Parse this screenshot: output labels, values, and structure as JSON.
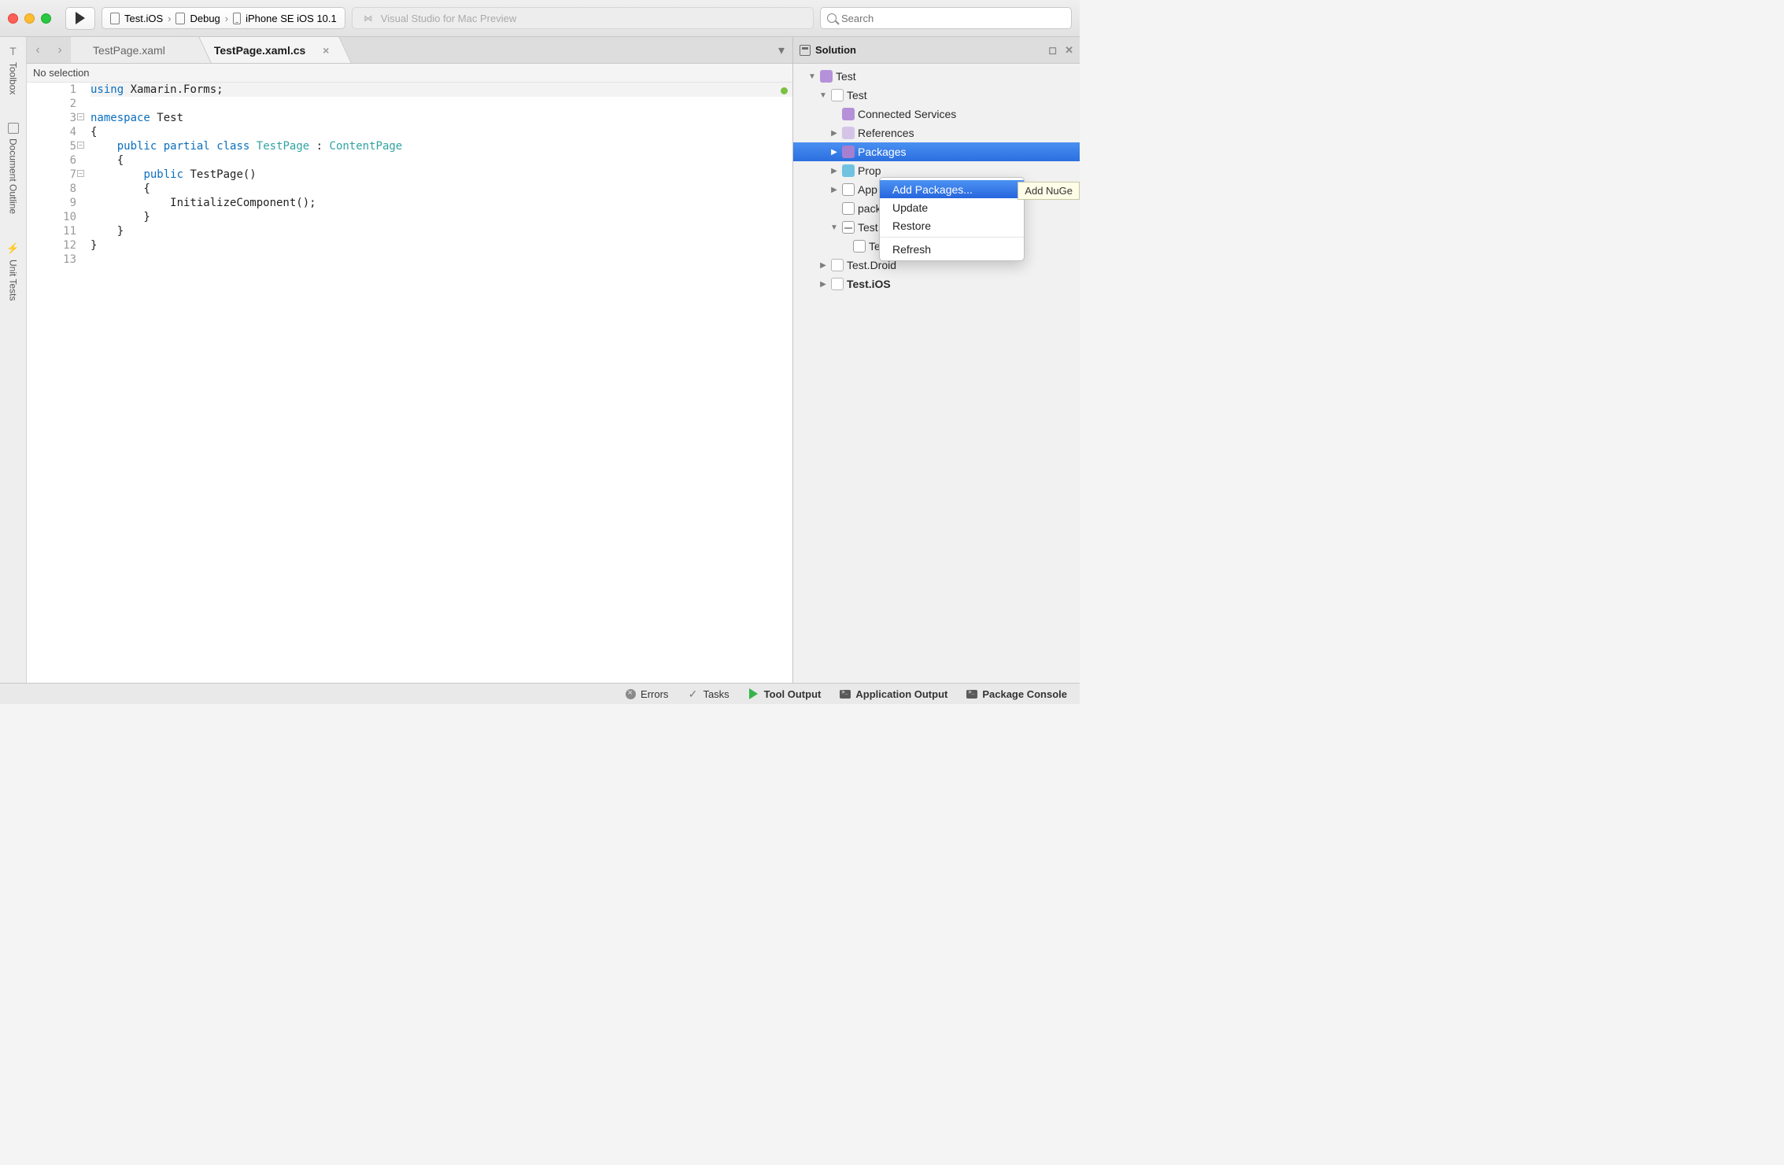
{
  "toolbar": {
    "breadcrumb": {
      "project": "Test.iOS",
      "config": "Debug",
      "device": "iPhone SE iOS 10.1"
    },
    "title": "Visual Studio for Mac Preview",
    "search_placeholder": "Search"
  },
  "left_tabs": [
    "Toolbox",
    "Document Outline",
    "Unit Tests"
  ],
  "editor": {
    "nav_label": "No selection",
    "tabs": [
      {
        "label": "TestPage.xaml",
        "active": false
      },
      {
        "label": "TestPage.xaml.cs",
        "active": true
      }
    ],
    "code_lines": [
      {
        "n": 1,
        "seg": [
          [
            "kw",
            "using"
          ],
          [
            "plain",
            " Xamarin.Forms;"
          ]
        ],
        "fold": false
      },
      {
        "n": 2,
        "seg": [],
        "fold": false
      },
      {
        "n": 3,
        "seg": [
          [
            "kw",
            "namespace"
          ],
          [
            "plain",
            " Test"
          ]
        ],
        "fold": true
      },
      {
        "n": 4,
        "seg": [
          [
            "plain",
            "{"
          ]
        ],
        "fold": false
      },
      {
        "n": 5,
        "seg": [
          [
            "plain",
            "    "
          ],
          [
            "kw",
            "public"
          ],
          [
            "plain",
            " "
          ],
          [
            "kw",
            "partial"
          ],
          [
            "plain",
            " "
          ],
          [
            "kw",
            "class"
          ],
          [
            "plain",
            " "
          ],
          [
            "type",
            "TestPage"
          ],
          [
            "plain",
            " : "
          ],
          [
            "type",
            "ContentPage"
          ]
        ],
        "fold": true
      },
      {
        "n": 6,
        "seg": [
          [
            "plain",
            "    {"
          ]
        ],
        "fold": false
      },
      {
        "n": 7,
        "seg": [
          [
            "plain",
            "        "
          ],
          [
            "kw",
            "public"
          ],
          [
            "plain",
            " TestPage()"
          ]
        ],
        "fold": true
      },
      {
        "n": 8,
        "seg": [
          [
            "plain",
            "        {"
          ]
        ],
        "fold": false
      },
      {
        "n": 9,
        "seg": [
          [
            "plain",
            "            InitializeComponent();"
          ]
        ],
        "fold": false
      },
      {
        "n": 10,
        "seg": [
          [
            "plain",
            "        }"
          ]
        ],
        "fold": false
      },
      {
        "n": 11,
        "seg": [
          [
            "plain",
            "    }"
          ]
        ],
        "fold": false
      },
      {
        "n": 12,
        "seg": [
          [
            "plain",
            "}"
          ]
        ],
        "fold": false
      },
      {
        "n": 13,
        "seg": [],
        "fold": false
      }
    ]
  },
  "solution": {
    "title": "Solution",
    "tree": [
      {
        "indent": 1,
        "twisty": "down",
        "icon": "ic-sol",
        "label": "Test",
        "bold": false
      },
      {
        "indent": 2,
        "twisty": "down",
        "icon": "ic-proj",
        "label": "Test",
        "bold": false
      },
      {
        "indent": 3,
        "twisty": "none",
        "icon": "ic-svc",
        "label": "Connected Services",
        "bold": false
      },
      {
        "indent": 3,
        "twisty": "right",
        "icon": "ic-ref",
        "label": "References",
        "bold": false
      },
      {
        "indent": 3,
        "twisty": "right",
        "icon": "ic-pkg",
        "label": "Packages",
        "bold": false,
        "selected": true
      },
      {
        "indent": 3,
        "twisty": "right",
        "icon": "ic-folder",
        "label": "Prop",
        "bold": false
      },
      {
        "indent": 3,
        "twisty": "right",
        "icon": "ic-code",
        "label": "App",
        "bold": false
      },
      {
        "indent": 3,
        "twisty": "none",
        "icon": "ic-code",
        "label": "pack",
        "bold": false
      },
      {
        "indent": 3,
        "twisty": "down",
        "icon": "ic-xaml",
        "label": "Test",
        "bold": false
      },
      {
        "indent": 4,
        "twisty": "none",
        "icon": "ic-code",
        "label": "TestPage.xaml.cs",
        "bold": false
      },
      {
        "indent": 2,
        "twisty": "right",
        "icon": "ic-proj",
        "label": "Test.Droid",
        "bold": false
      },
      {
        "indent": 2,
        "twisty": "right",
        "icon": "ic-proj",
        "label": "Test.iOS",
        "bold": true
      }
    ]
  },
  "context_menu": {
    "items": [
      "Add Packages...",
      "Update",
      "Restore",
      "Refresh"
    ],
    "highlighted": "Add Packages...",
    "tooltip": "Add NuGe"
  },
  "status_bar": {
    "items": [
      {
        "icon": "err",
        "label": "Errors",
        "bold": false
      },
      {
        "icon": "check",
        "label": "Tasks",
        "bold": false
      },
      {
        "icon": "play",
        "label": "Tool Output",
        "bold": true
      },
      {
        "icon": "term",
        "label": "Application Output",
        "bold": true
      },
      {
        "icon": "term",
        "label": "Package Console",
        "bold": true
      }
    ]
  }
}
